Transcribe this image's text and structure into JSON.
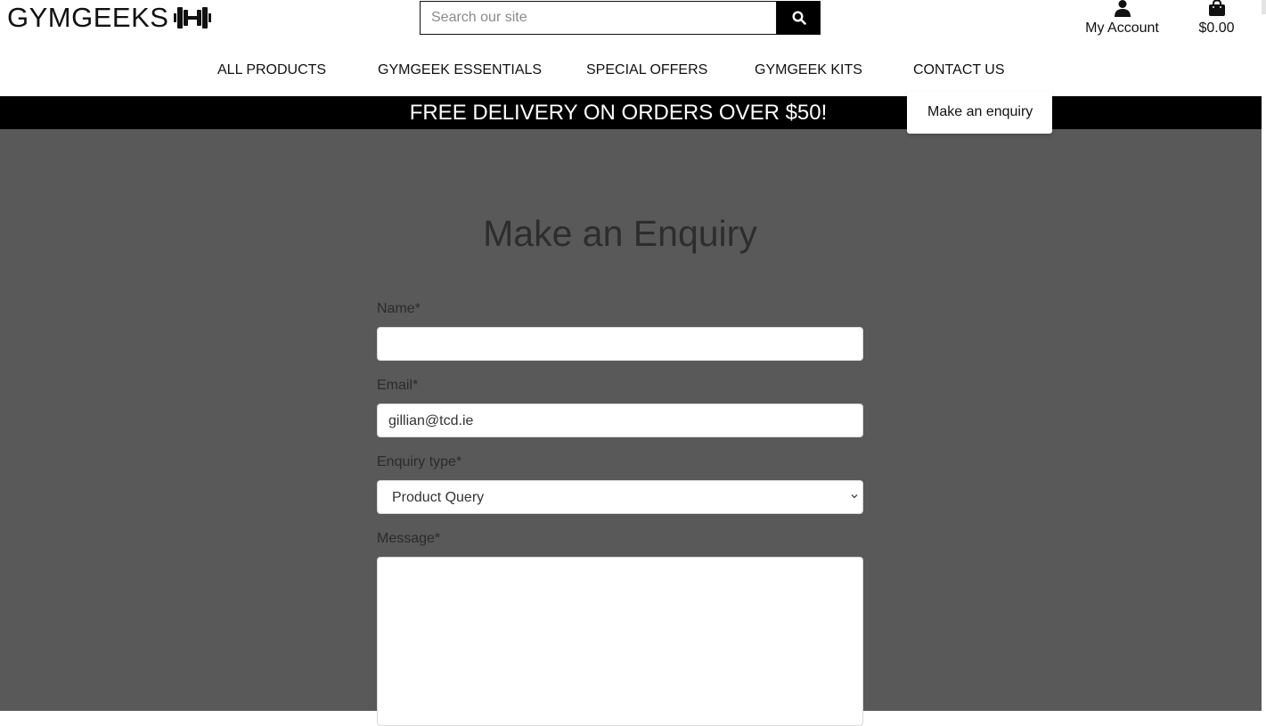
{
  "brand": {
    "name": "GYMGEEKS",
    "logo_icon": "dumbbell-icon"
  },
  "search": {
    "placeholder": "Search our site",
    "icon": "search-icon"
  },
  "account": {
    "label": "My Account",
    "icon": "user-icon"
  },
  "bag": {
    "total": "$0.00",
    "icon": "shopping-bag-icon"
  },
  "nav": {
    "items": [
      {
        "label": "ALL PRODUCTS"
      },
      {
        "label": "GYMGEEK ESSENTIALS"
      },
      {
        "label": "SPECIAL OFFERS"
      },
      {
        "label": "GYMGEEK KITS"
      },
      {
        "label": "CONTACT US"
      }
    ],
    "dropdown": {
      "items": [
        {
          "label": "Make an enquiry"
        }
      ]
    }
  },
  "banner": {
    "text": "FREE DELIVERY ON ORDERS OVER $50!"
  },
  "form": {
    "title": "Make an Enquiry",
    "name": {
      "label": "Name*",
      "value": ""
    },
    "email": {
      "label": "Email*",
      "value": "gillian@tcd.ie"
    },
    "enquiry_type": {
      "label": "Enquiry type*",
      "value": "Product Query"
    },
    "message": {
      "label": "Message*",
      "value": ""
    }
  },
  "colors": {
    "page_bg": "#595959",
    "banner_bg": "#000000",
    "header_bg": "#ffffff"
  }
}
